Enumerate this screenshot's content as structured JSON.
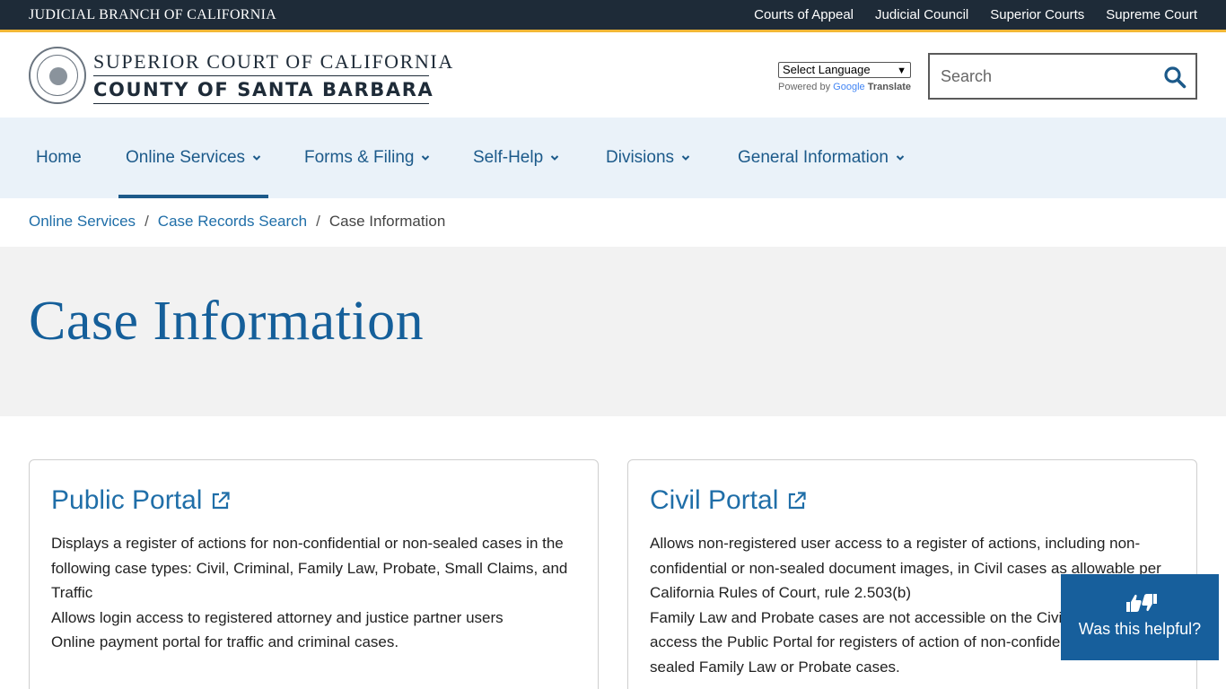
{
  "topbar": {
    "brand": "JUDICIAL BRANCH OF CALIFORNIA",
    "links": [
      "Courts of Appeal",
      "Judicial Council",
      "Superior Courts",
      "Supreme Court"
    ]
  },
  "header": {
    "logo_line1": "SUPERIOR COURT OF CALIFORNIA",
    "logo_line2": "COUNTY OF SANTA BARBARA",
    "language_select": "Select Language",
    "powered_by": "Powered by",
    "google": "Google",
    "translate": "Translate",
    "search_placeholder": "Search"
  },
  "nav": {
    "items": [
      {
        "label": "Home"
      },
      {
        "label": "Online Services"
      },
      {
        "label": "Forms & Filing"
      },
      {
        "label": "Self-Help"
      },
      {
        "label": "Divisions"
      },
      {
        "label": "General Information"
      }
    ]
  },
  "breadcrumb": {
    "items": [
      "Online Services",
      "Case Records Search"
    ],
    "current": "Case Information",
    "separator": "/"
  },
  "page": {
    "title": "Case Information"
  },
  "cards": [
    {
      "title": "Public Portal",
      "lines": [
        "Displays a register of actions for non-confidential or non-sealed cases in the following case types: Civil, Criminal, Family Law, Probate, Small Claims, and Traffic",
        "Allows login access to registered attorney and justice partner users",
        "Online payment portal for traffic and criminal cases."
      ]
    },
    {
      "title": "Civil Portal",
      "lines": [
        "Allows non-registered user access to a register of actions, including non-confidential or non-sealed document images, in Civil cases as allowable per California Rules of Court, rule 2.503(b)",
        "Family Law and Probate cases are not accessible on the Civil Portal. Please access the Public Portal for registers of action of non-confidential or non-sealed Family Law or Probate cases."
      ]
    }
  ],
  "helpful": {
    "label": "Was this helpful?"
  },
  "colors": {
    "topbar": "#1e2b38",
    "accent_gold": "#f2b736",
    "link_blue": "#1f6ea8",
    "nav_bg": "#eaf2f9",
    "title_band": "#f2f2f2",
    "helpful_bg": "#175f9c"
  }
}
